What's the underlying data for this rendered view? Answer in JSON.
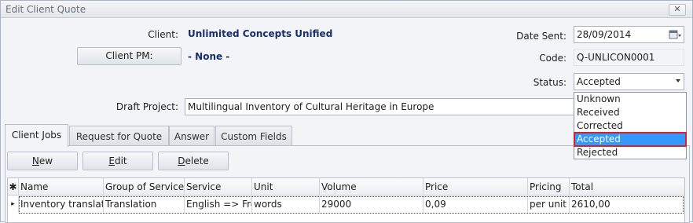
{
  "window": {
    "title": "Edit Client Quote",
    "close_glyph": "✕"
  },
  "form": {
    "client_label": "Client:",
    "client_value": "Unlimited Concepts Unified",
    "client_pm_button": "Client PM:",
    "client_pm_value": "- None -",
    "draft_project_label": "Draft Project:",
    "draft_project_value": "Multilingual Inventory of Cultural Heritage in Europe",
    "date_sent_label": "Date Sent:",
    "date_sent_value": "28/09/2014",
    "code_label": "Code:",
    "code_value": "Q-UNLICON0001",
    "status_label": "Status:",
    "status_value": "Accepted"
  },
  "status_dropdown": {
    "options": [
      "Unknown",
      "Received",
      "Corrected",
      "Accepted",
      "Rejected"
    ],
    "selected": "Accepted"
  },
  "tabs": [
    "Client Jobs",
    "Request for Quote",
    "Answer",
    "Custom Fields"
  ],
  "active_tab": "Client Jobs",
  "toolbar": {
    "new_mnemonic": "N",
    "new_rest": "ew",
    "edit_mnemonic": "E",
    "edit_rest": "dit",
    "delete_mnemonic": "D",
    "delete_rest": "elete"
  },
  "grid": {
    "new_row_glyph": "✱",
    "current_row_glyph": "▸",
    "columns": [
      "Name",
      "Group of Service",
      "Service",
      "Unit",
      "Volume",
      "Price",
      "Pricing",
      "Total"
    ],
    "rows": [
      [
        "Inventory translati",
        "Translation",
        "English => Fre",
        "words",
        "29000",
        "0,09",
        "per unit",
        "2610,00"
      ]
    ]
  }
}
